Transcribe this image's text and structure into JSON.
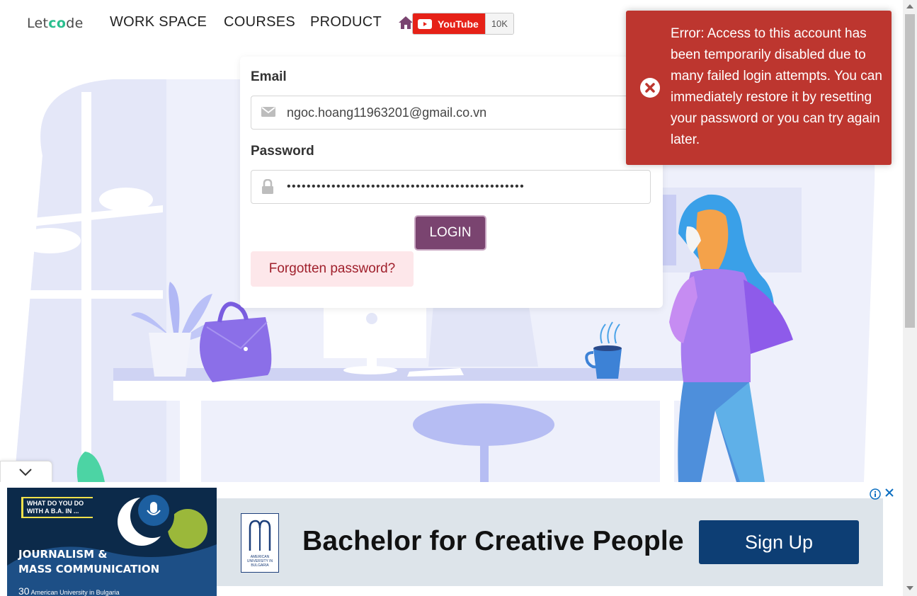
{
  "header": {
    "logo_pre": "Let",
    "logo_o": "co",
    "logo_post": "de",
    "nav": [
      "WORK SPACE",
      "COURSES",
      "PRODUCT"
    ],
    "youtube_label": "YouTube",
    "youtube_count": "10K"
  },
  "login": {
    "email_label": "Email",
    "email_value": "ngoc.hoang11963201@gmail.co.vn",
    "password_label": "Password",
    "password_value": "••••••••••••••••••••••••••••••••••••••••••••••••",
    "login_button": "LOGIN",
    "forgot_link": "Forgotten password?"
  },
  "toast": {
    "message": "Error: Access to this account has been temporarily disabled due to many failed login attempts. You can immediately restore it by resetting your password or you can try again later.",
    "color": "#bd362f"
  },
  "ad": {
    "question": "WHAT DO YOU DO WITH A B.A. IN ...",
    "headline_1": "JOURNALISM &",
    "headline_2": "MASS COMMUNICATION",
    "footer": "American University in Bulgaria",
    "anniv": "30",
    "logo_text": "AMERICAN UNIVERSITY IN BULGARIA",
    "title": "Bachelor for Creative People",
    "button": "Sign Up"
  },
  "colors": {
    "login_button": "#7a4470",
    "forgot_bg": "#fde7ea",
    "accent_purple": "#8b6fe8"
  }
}
